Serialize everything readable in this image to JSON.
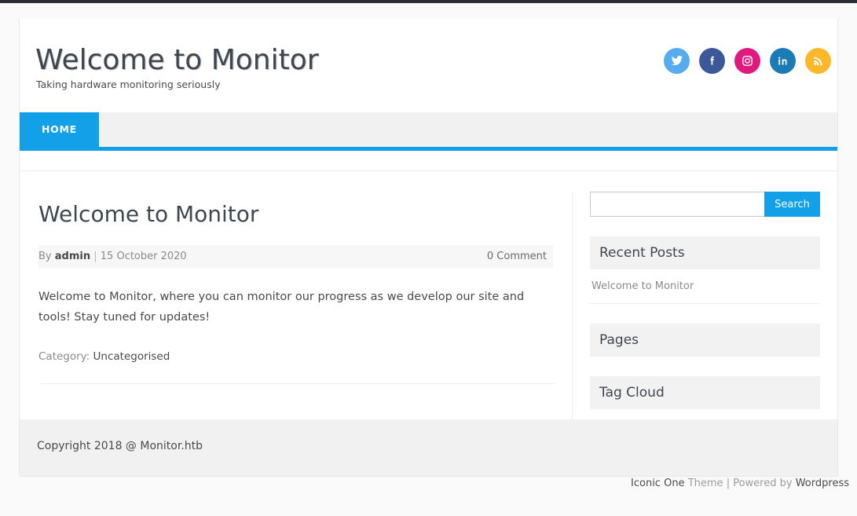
{
  "site": {
    "title": "Welcome to Monitor",
    "description": "Taking hardware monitoring seriously"
  },
  "social": {
    "icons": [
      {
        "name": "twitter-icon",
        "label": "Twitter",
        "color": "#55acee"
      },
      {
        "name": "facebook-icon",
        "label": "Facebook",
        "color": "#3b5998"
      },
      {
        "name": "instagram-icon",
        "label": "Instagram",
        "color": "#e0197e"
      },
      {
        "name": "linkedin-icon",
        "label": "LinkedIn",
        "color": "#1b7cb5"
      },
      {
        "name": "rss-icon",
        "label": "RSS",
        "color": "#fcb72a"
      }
    ]
  },
  "nav": {
    "items": [
      {
        "label": "HOME",
        "active": true
      }
    ],
    "accent_color": "#12a0e8"
  },
  "post": {
    "title": "Welcome to Monitor",
    "meta": {
      "by_prefix": "By",
      "author": "admin",
      "separator": "|",
      "date": "15 October 2020",
      "comments": "0 Comment"
    },
    "body": "Welcome to Monitor, where you can monitor our progress as we develop our site and tools! Stay tuned for updates!",
    "category_label": "Category:",
    "category_value": "Uncategorised"
  },
  "sidebar": {
    "search": {
      "value": "",
      "placeholder": "",
      "button_label": "Search"
    },
    "widgets": [
      {
        "title": "Recent Posts",
        "items": [
          "Welcome to Monitor"
        ]
      },
      {
        "title": "Pages",
        "items": []
      },
      {
        "title": "Tag Cloud",
        "items": []
      }
    ]
  },
  "footer": {
    "copyright": "Copyright 2018 @ Monitor.htb",
    "credit": {
      "theme_name": "Iconic One",
      "theme_word": "Theme",
      "separator": "|",
      "powered_by": "Powered by",
      "platform": "Wordpress"
    }
  }
}
